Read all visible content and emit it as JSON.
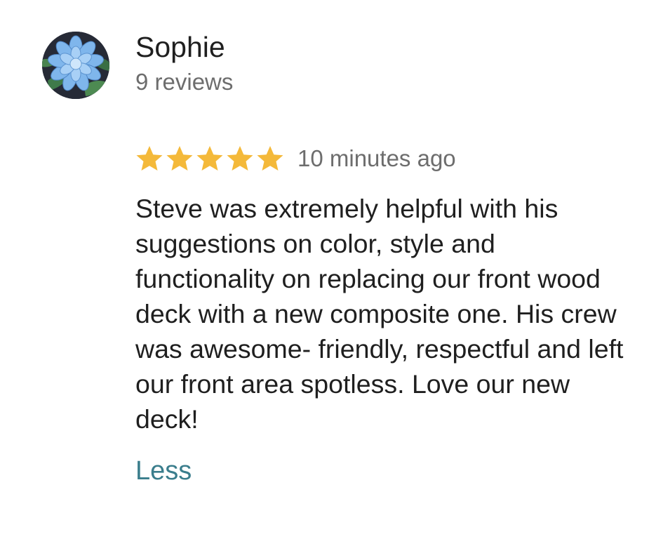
{
  "reviewer": {
    "name": "Sophie",
    "review_count": "9 reviews",
    "avatar_icon": "blue-flower-avatar"
  },
  "review": {
    "rating": 5,
    "rating_max": 5,
    "star_color": "#f4b93a",
    "timestamp": "10 minutes ago",
    "text": "Steve was extremely helpful with his suggestions on color, style and functionality on replacing our front wood deck with a new composite one. His crew was awesome- friendly, respectful and left our front area spotless. Love our new deck!",
    "less_label": "Less",
    "link_color": "#3a7d8c"
  }
}
